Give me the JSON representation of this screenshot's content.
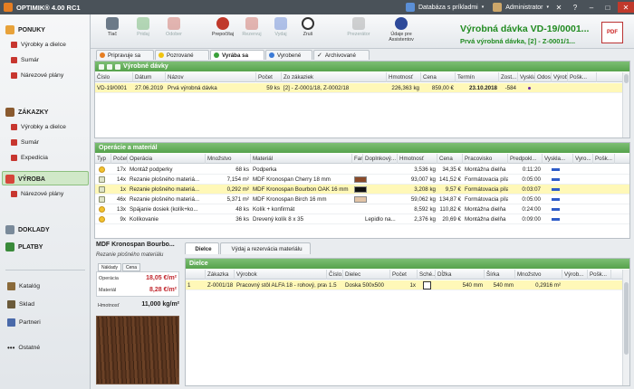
{
  "app": {
    "title": "OPTIMIK® 4.00 RC1",
    "database": "Databáza s príkladmi",
    "user": "Administrator"
  },
  "colors": {
    "green": "#218b21",
    "accent": "#56a24c",
    "highlight": "#fff8b8"
  },
  "sidebar": {
    "sections": [
      {
        "label": "PONUKY",
        "icon": "folder-icon",
        "items": [
          "Výrobky a dielce",
          "Sumár",
          "Nárezové plány"
        ]
      },
      {
        "label": "ZÁKAZKY",
        "icon": "briefcase-icon",
        "items": [
          "Výrobky a dielce",
          "Sumár",
          "Expedícia"
        ]
      },
      {
        "label": "VÝROBA",
        "icon": "factory-icon",
        "items": [
          "Nárezové plány"
        ]
      },
      {
        "label": "DOKLADY",
        "icon": "documents-icon",
        "items": []
      },
      {
        "label": "PLATBY",
        "icon": "payments-icon",
        "items": []
      }
    ],
    "bottom": [
      "Katalóg",
      "Sklad",
      "Partneri",
      "Ostatné"
    ]
  },
  "toolbar": {
    "buttons": [
      "Tlač",
      "Pridaj",
      "Odober",
      "Prepočítaj",
      "Rezervuj",
      "Vydaj",
      "Zruš",
      "Prezerátor",
      "Údaje pre Assistentov"
    ],
    "heading": "Výrobná dávka VD-19/0001...",
    "subheading": "Prvá výrobná dávka, [2] - Z-0001/1...",
    "pdf_label": "PDF"
  },
  "status_tabs": [
    "Pripravuje sa",
    "Pozrované",
    "Vyrába sa",
    "Vyrobené",
    "Archivované"
  ],
  "batches": {
    "title": "Výrobné dávky",
    "columns": [
      "Číslo",
      "Dátum",
      "Názov",
      "Počet",
      "Zo zákaziek",
      "Hmotnosť",
      "Cena",
      "Termín",
      "Zost...",
      "Vyskladn...",
      "Odosl...",
      "Výrobe...",
      "Pošk..."
    ],
    "rows": [
      [
        "VD-19/0001",
        "27.06.2019",
        "Prvá výrobná dávka",
        "59 ks",
        "[2] - Z-0001/18, Z-0002/18",
        "226,363 kg",
        "859,00 €",
        "23.10.2018",
        "-584"
      ]
    ]
  },
  "operations": {
    "title": "Operácie a materiál",
    "columns": [
      "Typ",
      "Počet",
      "Operácia",
      "Množstvo",
      "Materiál",
      "Farba",
      "Doplnkový...",
      "Hmotnosť",
      "Cena",
      "Pracovisko",
      "Predpokl...",
      "Vyskla...",
      "Vyro...",
      "Pošk..."
    ],
    "rows": [
      {
        "count": "17x",
        "op": "Montáž podperky",
        "qty": "68 ks",
        "mat": "Podperka",
        "extra": "",
        "weight": "3,536 kg",
        "price": "34,35 €",
        "place": "Montážna dielňa",
        "time": "0:11:20",
        "color": "",
        "type": "circle"
      },
      {
        "count": "14x",
        "op": "Rezanie plošného materiá...",
        "qty": "7,154 m²",
        "mat": "MDF Kronospan Cherry 18 mm",
        "extra": "",
        "weight": "93,007 kg",
        "price": "141,52 €",
        "place": "Formátovacia píla",
        "time": "0:05:00",
        "color": "#8a4a2a",
        "type": "box"
      },
      {
        "count": "1x",
        "op": "Rezanie plošného materiá...",
        "qty": "0,292 m²",
        "mat": "MDF Kronospan Bourbon OAK 16 mm",
        "extra": "",
        "weight": "3,208 kg",
        "price": "9,57 €",
        "place": "Formátovacia píla",
        "time": "0:03:07",
        "color": "#111111",
        "type": "box"
      },
      {
        "count": "46x",
        "op": "Rezanie plošného materiá...",
        "qty": "5,371 m²",
        "mat": "MDF Kronospan Birch 16 mm",
        "extra": "",
        "weight": "59,062 kg",
        "price": "134,87 €",
        "place": "Formátovacia píla",
        "time": "0:05:00",
        "color": "#e2c4a6",
        "type": "box"
      },
      {
        "count": "13x",
        "op": "Spájanie dosiek (kolík+ko...",
        "qty": "48 ks",
        "mat": "Kolík + konfirmát",
        "extra": "",
        "weight": "8,592 kg",
        "price": "110,82 €",
        "place": "Montážna dielňa",
        "time": "0:24:00",
        "color": "",
        "type": "circle"
      },
      {
        "count": "9x",
        "op": "Kolíkovanie",
        "qty": "36 ks",
        "mat": "Drevený kolík 8 x 35",
        "extra": "Lepidlo na...",
        "weight": "2,376 kg",
        "price": "20,69 €",
        "place": "Montážna dielňa",
        "time": "0:09:00",
        "color": "",
        "type": "circle"
      }
    ]
  },
  "material": {
    "title": "MDF Kronospan Bourbo...",
    "subtitle": "Rezanie plošného materiálu",
    "tabs": [
      "Náklady",
      "Cena"
    ],
    "rows": [
      {
        "label": "Operácia",
        "value": "18,05 €/m²"
      },
      {
        "label": "Materiál",
        "value": "8,28 €/m²"
      }
    ],
    "weight_label": "Hmotnosť",
    "weight_value": "11,000 kg/m²"
  },
  "bottom_tabs": [
    "Dielce",
    "Výdaj a rezervácia materiálu"
  ],
  "parts": {
    "title": "Dielce",
    "columns": [
      "Zákazka",
      "Výrobok",
      "Číslo...",
      "Dielec",
      "Počet",
      "Sché...",
      "Dĺžka",
      "Šírka",
      "Množstvo",
      "Výrob...",
      "Pošk..."
    ],
    "rows": [
      [
        "1",
        "Z-0001/18",
        "Pracovný stôl ALFA 18 - rohový, pravý",
        "1.5",
        "Doska 500x500",
        "1x",
        "",
        "540 mm",
        "540 mm",
        "0,2916 m²"
      ]
    ]
  }
}
